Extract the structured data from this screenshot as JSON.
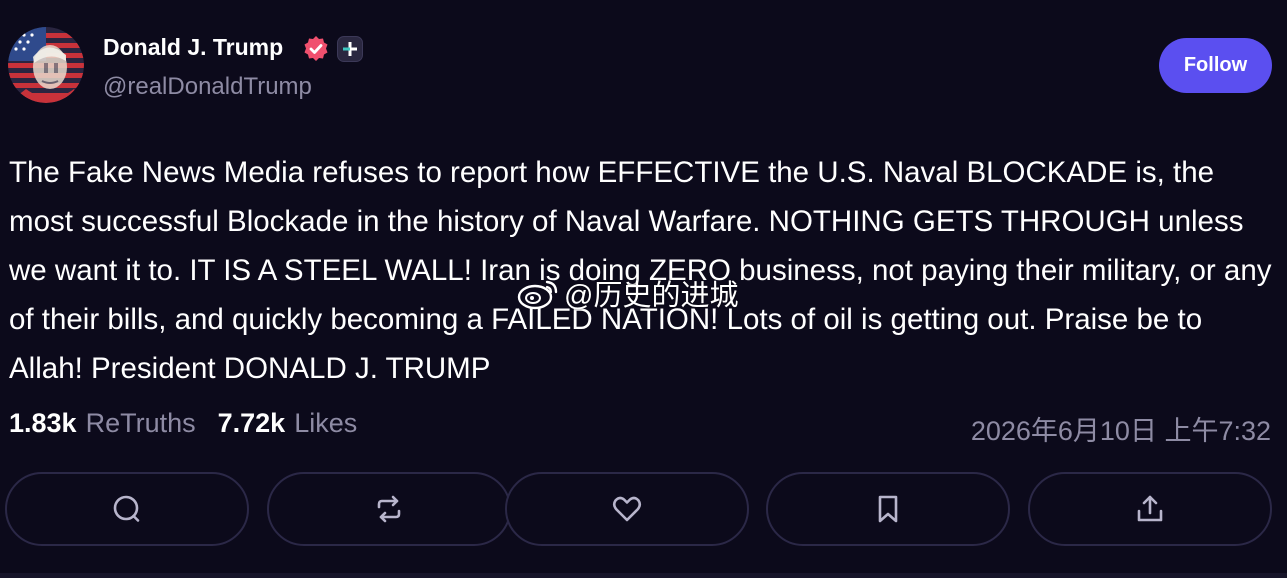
{
  "author": {
    "display_name": "Donald J. Trump",
    "handle": "@realDonaldTrump",
    "avatar_icon": "flag-portrait-avatar",
    "verified_icon": "verified-badge-icon",
    "verified_color": "#f0506e",
    "plus_icon": "plus-badge-icon"
  },
  "follow_button": {
    "label": "Follow",
    "color": "#5b4ff0"
  },
  "post": {
    "text": "The Fake News Media refuses to report how EFFECTIVE the U.S. Naval BLOCKADE is, the most successful Blockade in the history of Naval Warfare. NOTHING GETS THROUGH unless we want it to. IT IS A STEEL WALL! Iran is doing ZERO business, not paying their military, or any of their bills, and quickly becoming a FAILED NATION! Lots of oil is getting out. Praise be to Allah! President DONALD J. TRUMP"
  },
  "watermark": {
    "text": "@历史的进城",
    "icon": "weibo-logo-icon"
  },
  "stats": {
    "retruths_count": "1.83k",
    "retruths_label": "ReTruths",
    "likes_count": "7.72k",
    "likes_label": "Likes"
  },
  "timestamp": "2026年6月10日 上午7:32",
  "actions": [
    {
      "name": "reply",
      "icon": "reply-icon"
    },
    {
      "name": "retruth",
      "icon": "retruth-icon"
    },
    {
      "name": "like",
      "icon": "heart-icon"
    },
    {
      "name": "bookmark",
      "icon": "bookmark-icon"
    },
    {
      "name": "share",
      "icon": "share-icon"
    }
  ],
  "colors": {
    "background": "#0c0a1b",
    "muted_text": "#8e8ba4",
    "button_border": "#2b2847",
    "icon_color": "#b8b5cc"
  }
}
